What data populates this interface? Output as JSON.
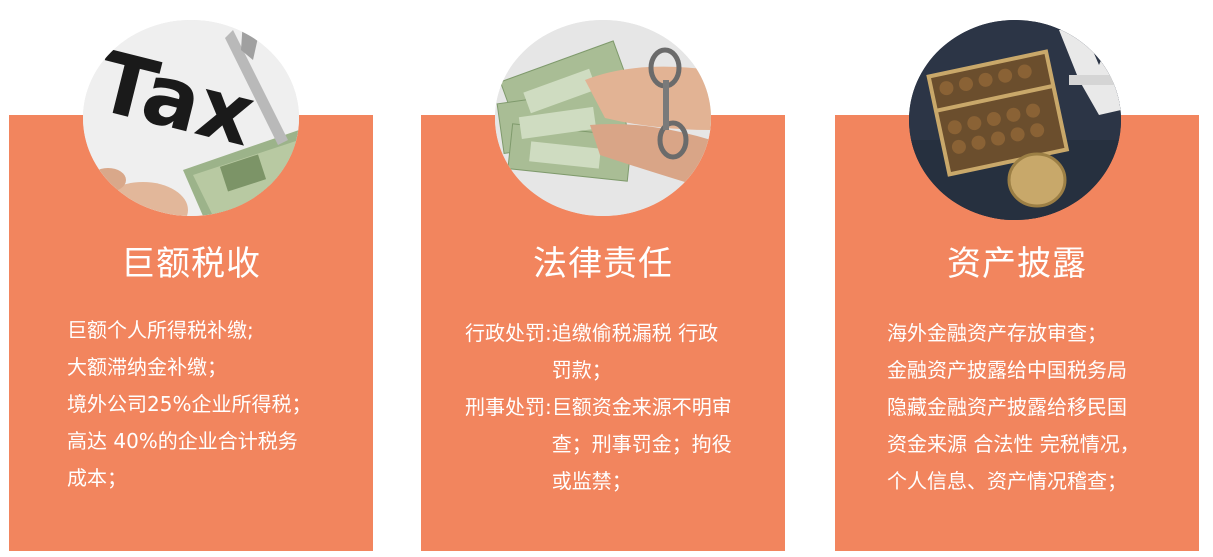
{
  "cards": [
    {
      "title": "巨额税收",
      "image": "tax-scissors-money-photo",
      "image_text": "Tax",
      "lines": [
        "巨额个人所得税补缴;",
        "大额滞纳金补缴；",
        "境外公司25%企业所得税；",
        "高达 40%的企业合计税务",
        "成本；"
      ]
    },
    {
      "title": "法律责任",
      "image": "handcuffed-hands-money-photo",
      "items": [
        {
          "label": "行政处罚:",
          "text": "追缴偷税漏税 行政罚款；"
        },
        {
          "label": "刑事处罚:",
          "text": "巨额资金来源不明审查；刑事罚金；拘役或监禁；"
        }
      ]
    },
    {
      "title": "资产披露",
      "image": "abacus-coin-yen-photo",
      "lines": [
        "海外金融资产存放审查；",
        "金融资产披露给中国税务局",
        "隐藏金融资产披露给移民国",
        "资金来源 合法性 完税情况，",
        "个人信息、资产情况稽查；"
      ]
    }
  ],
  "colors": {
    "card_bg": "#f2855e",
    "text": "#ffffff"
  }
}
